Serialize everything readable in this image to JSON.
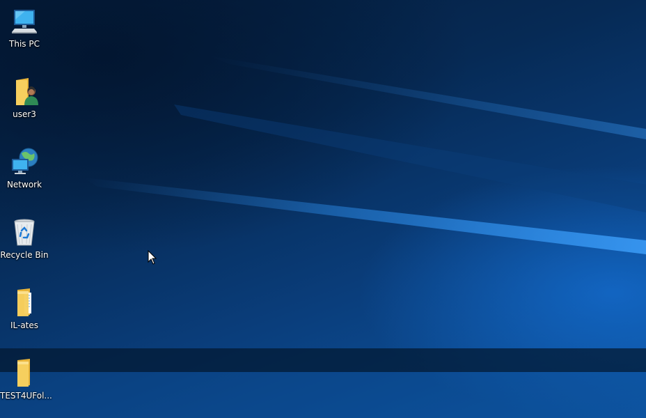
{
  "desktop": {
    "icons": [
      {
        "label": "This PC",
        "icon": "this-pc-icon"
      },
      {
        "label": "user3",
        "icon": "user-folder-icon"
      },
      {
        "label": "Network",
        "icon": "network-icon"
      },
      {
        "label": "Recycle Bin",
        "icon": "recycle-bin-icon"
      },
      {
        "label": "IL-ates",
        "icon": "folder-icon"
      },
      {
        "label": "TEST4UFol...",
        "icon": "folder-icon"
      }
    ]
  },
  "colors": {
    "wallpaper_dark": "#041c3a",
    "wallpaper_light": "#0e58a8",
    "folder_yellow": "#f4c24d",
    "label_text": "#ffffff"
  }
}
